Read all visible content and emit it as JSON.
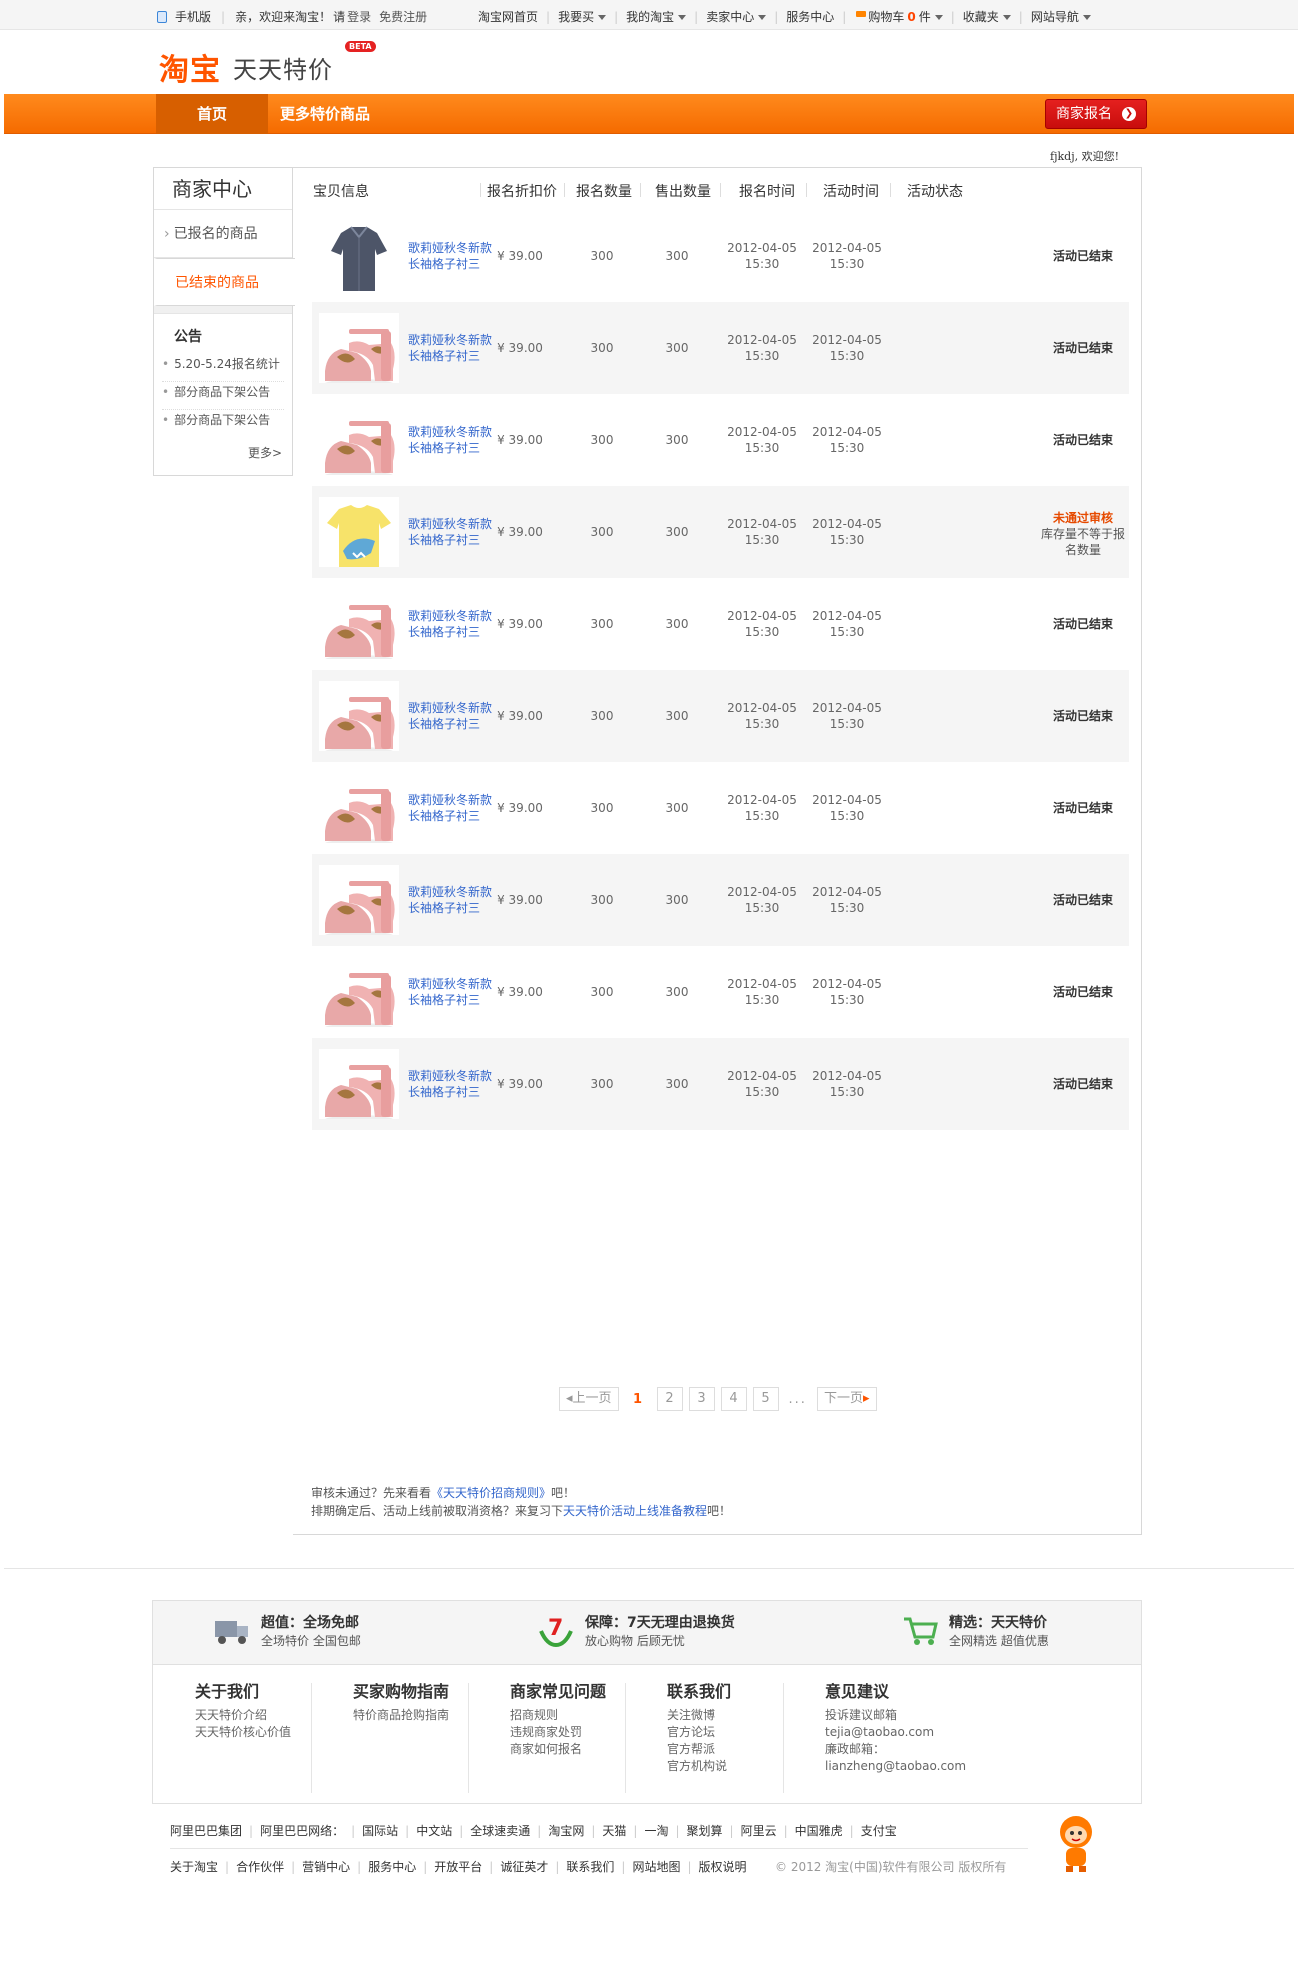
{
  "topbar": {
    "mobile": "手机版",
    "welcome_prefix": "亲，欢迎来淘宝！",
    "please": "请",
    "login": "登录",
    "register": "免费注册",
    "links": [
      "淘宝网首页",
      "我要买",
      "我的淘宝",
      "卖家中心",
      "服务中心",
      "购物车",
      "收藏夹",
      "网站导航"
    ],
    "cart_count": "0",
    "cart_unit": "件"
  },
  "header": {
    "logo": "淘宝",
    "subtitle": "天天特价",
    "beta": "BETA"
  },
  "nav": {
    "home": "首页",
    "more": "更多特价商品",
    "merchant_signup": "商家报名"
  },
  "welcome": "fjkdj, 欢迎您!",
  "sidebar": {
    "title": "商家中心",
    "items": [
      "已报名的商品",
      "已结束的商品"
    ],
    "notice_title": "公告",
    "notices": [
      "5.20-5.24报名统计",
      "部分商品下架公告",
      "部分商品下架公告"
    ],
    "more": "更多>"
  },
  "table": {
    "headers": [
      "宝贝信息",
      "报名折扣价",
      "报名数量",
      "售出数量",
      "报名时间",
      "活动时间",
      "活动状态"
    ],
    "rows": [
      {
        "thumb": "shirt",
        "name": "歌莉娅秋冬新款长袖格子衬三",
        "price": "¥ 39.00",
        "qty": "300",
        "sold": "300",
        "signup_date": "2012-04-05",
        "signup_time": "15:30",
        "act_date": "2012-04-05",
        "act_time": "15:30",
        "status": "活动已结束"
      },
      {
        "thumb": "shoe",
        "name": "歌莉娅秋冬新款长袖格子衬三",
        "price": "¥ 39.00",
        "qty": "300",
        "sold": "300",
        "signup_date": "2012-04-05",
        "signup_time": "15:30",
        "act_date": "2012-04-05",
        "act_time": "15:30",
        "status": "活动已结束"
      },
      {
        "thumb": "shoe",
        "name": "歌莉娅秋冬新款长袖格子衬三",
        "price": "¥ 39.00",
        "qty": "300",
        "sold": "300",
        "signup_date": "2012-04-05",
        "signup_time": "15:30",
        "act_date": "2012-04-05",
        "act_time": "15:30",
        "status": "活动已结束"
      },
      {
        "thumb": "tshirt",
        "name": "歌莉娅秋冬新款长袖格子衬三",
        "price": "¥ 39.00",
        "qty": "300",
        "sold": "300",
        "signup_date": "2012-04-05",
        "signup_time": "15:30",
        "act_date": "2012-04-05",
        "act_time": "15:30",
        "status": "未通过审核",
        "status_note": "库存量不等于报名数量"
      },
      {
        "thumb": "shoe",
        "name": "歌莉娅秋冬新款长袖格子衬三",
        "price": "¥ 39.00",
        "qty": "300",
        "sold": "300",
        "signup_date": "2012-04-05",
        "signup_time": "15:30",
        "act_date": "2012-04-05",
        "act_time": "15:30",
        "status": "活动已结束"
      },
      {
        "thumb": "shoe",
        "name": "歌莉娅秋冬新款长袖格子衬三",
        "price": "¥ 39.00",
        "qty": "300",
        "sold": "300",
        "signup_date": "2012-04-05",
        "signup_time": "15:30",
        "act_date": "2012-04-05",
        "act_time": "15:30",
        "status": "活动已结束"
      },
      {
        "thumb": "shoe",
        "name": "歌莉娅秋冬新款长袖格子衬三",
        "price": "¥ 39.00",
        "qty": "300",
        "sold": "300",
        "signup_date": "2012-04-05",
        "signup_time": "15:30",
        "act_date": "2012-04-05",
        "act_time": "15:30",
        "status": "活动已结束"
      },
      {
        "thumb": "shoe",
        "name": "歌莉娅秋冬新款长袖格子衬三",
        "price": "¥ 39.00",
        "qty": "300",
        "sold": "300",
        "signup_date": "2012-04-05",
        "signup_time": "15:30",
        "act_date": "2012-04-05",
        "act_time": "15:30",
        "status": "活动已结束"
      },
      {
        "thumb": "shoe",
        "name": "歌莉娅秋冬新款长袖格子衬三",
        "price": "¥ 39.00",
        "qty": "300",
        "sold": "300",
        "signup_date": "2012-04-05",
        "signup_time": "15:30",
        "act_date": "2012-04-05",
        "act_time": "15:30",
        "status": "活动已结束"
      },
      {
        "thumb": "shoe",
        "name": "歌莉娅秋冬新款长袖格子衬三",
        "price": "¥ 39.00",
        "qty": "300",
        "sold": "300",
        "signup_date": "2012-04-05",
        "signup_time": "15:30",
        "act_date": "2012-04-05",
        "act_time": "15:30",
        "status": "活动已结束"
      }
    ]
  },
  "pager": {
    "prev": "上一页",
    "pages": [
      "1",
      "2",
      "3",
      "4",
      "5"
    ],
    "current": "1",
    "dots": "...",
    "next": "下一页"
  },
  "tips": {
    "line1_a": "审核未通过？先来看看",
    "line1_link": "《天天特价招商规则》",
    "line1_b": "吧！",
    "line2_a": "排期确定后、活动上线前被取消资格？来复习下",
    "line2_link": "天天特价活动上线准备教程",
    "line2_b": "吧！"
  },
  "footer": {
    "guarantees": [
      {
        "icon": "truck-icon",
        "title": "超值：全场免邮",
        "sub": "全场特价  全国包邮"
      },
      {
        "icon": "seven-days-icon",
        "title": "保障：7天无理由退换货",
        "sub": "放心购物  后顾无忧"
      },
      {
        "icon": "cart-icon",
        "title": "精选：天天特价",
        "sub": "全网精选  超值优惠"
      }
    ],
    "columns": [
      {
        "title": "关于我们",
        "links": [
          "天天特价介绍",
          "天天特价核心价值"
        ]
      },
      {
        "title": "买家购物指南",
        "links": [
          "特价商品抢购指南"
        ]
      },
      {
        "title": "商家常见问题",
        "links": [
          "招商规则",
          "违规商家处罚",
          "商家如何报名"
        ]
      },
      {
        "title": "联系我们",
        "links": [
          "关注微博",
          "官方论坛",
          "官方帮派",
          "官方机构说"
        ]
      },
      {
        "title": "意见建议",
        "links": [
          "投诉建议邮箱",
          "tejia@taobao.com",
          "廉政邮箱：",
          "lianzheng@taobao.com"
        ]
      }
    ],
    "group_links": [
      "阿里巴巴集团",
      "阿里巴巴网络：",
      "国际站",
      "中文站",
      "全球速卖通",
      "淘宝网",
      "天猫",
      "一淘",
      "聚划算",
      "阿里云",
      "中国雅虎",
      "支付宝"
    ],
    "bottom_links": [
      "关于淘宝",
      "合作伙伴",
      "营销中心",
      "服务中心",
      "开放平台",
      "诚征英才",
      "联系我们",
      "网站地图",
      "版权说明"
    ],
    "copyright": "© 2012 淘宝(中国)软件有限公司 版权所有"
  }
}
